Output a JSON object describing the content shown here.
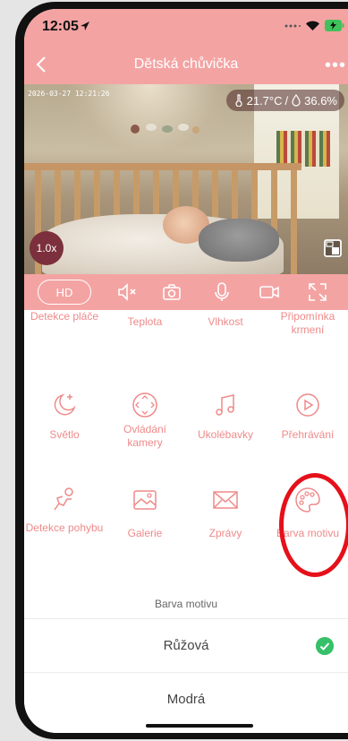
{
  "status_bar": {
    "time": "12:05"
  },
  "nav": {
    "title": "Dětská chůvička",
    "more": "•••"
  },
  "camera": {
    "timestamp": "2026-03-27 12:21:26",
    "temperature": "21.7°C",
    "separator": "/",
    "humidity": "36.6%",
    "zoom": "1.0x"
  },
  "controls": {
    "hd_label": "HD"
  },
  "features": [
    {
      "label": "Detekce pláče",
      "icon": "cry-detection-icon"
    },
    {
      "label": "Teplota",
      "icon": "thermometer-icon"
    },
    {
      "label": "Vlhkost",
      "icon": "humidity-icon"
    },
    {
      "label": "Připomínka krmení",
      "icon": "feeding-reminder-icon"
    },
    {
      "label": "Světlo",
      "icon": "moon-light-icon"
    },
    {
      "label": "Ovládání kamery",
      "icon": "camera-control-icon"
    },
    {
      "label": "Ukolébavky",
      "icon": "music-note-icon"
    },
    {
      "label": "Přehrávání",
      "icon": "play-icon"
    },
    {
      "label": "Detekce pohybu",
      "icon": "motion-detection-icon"
    },
    {
      "label": "Galerie",
      "icon": "gallery-icon"
    },
    {
      "label": "Zprávy",
      "icon": "envelope-icon"
    },
    {
      "label": "Barva motivu",
      "icon": "palette-icon"
    }
  ],
  "theme_sheet": {
    "title": "Barva motivu",
    "options": [
      {
        "label": "Růžová",
        "selected": true
      },
      {
        "label": "Modrá",
        "selected": false
      }
    ]
  },
  "colors": {
    "accent": "#f4a3a3",
    "accent_text": "#ef8a8a",
    "selected": "#36c069",
    "annotation": "#e5101a"
  }
}
